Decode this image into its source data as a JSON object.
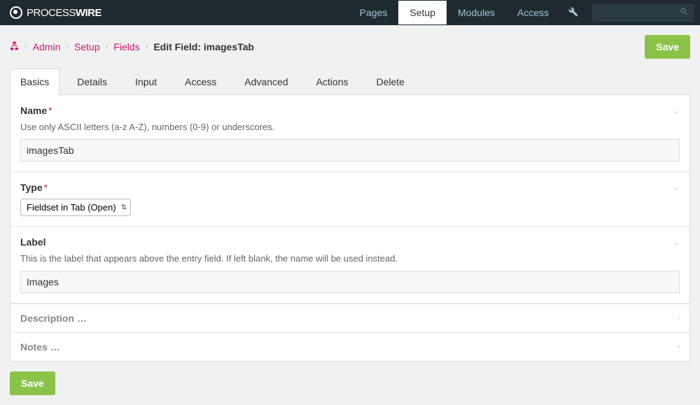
{
  "brand": {
    "name": "PROCESSWIRE"
  },
  "topnav": {
    "pages": "Pages",
    "setup": "Setup",
    "modules": "Modules",
    "access": "Access"
  },
  "search": {
    "placeholder": ""
  },
  "breadcrumb": {
    "admin": "Admin",
    "setup": "Setup",
    "fields": "Fields",
    "current": "Edit Field: imagesTab"
  },
  "buttons": {
    "save_top": "Save",
    "save_bottom": "Save"
  },
  "tabs": [
    "Basics",
    "Details",
    "Input",
    "Access",
    "Advanced",
    "Actions",
    "Delete"
  ],
  "fields": {
    "name": {
      "label": "Name",
      "help": "Use only ASCII letters (a-z A-Z), numbers (0-9) or underscores.",
      "value": "imagesTab"
    },
    "type": {
      "label": "Type",
      "value": "Fieldset in Tab (Open)"
    },
    "label_field": {
      "label": "Label",
      "help": "This is the label that appears above the entry field. If left blank, the name will be used instead.",
      "value": "Images"
    },
    "description": {
      "label": "Description …"
    },
    "notes": {
      "label": "Notes …"
    }
  }
}
